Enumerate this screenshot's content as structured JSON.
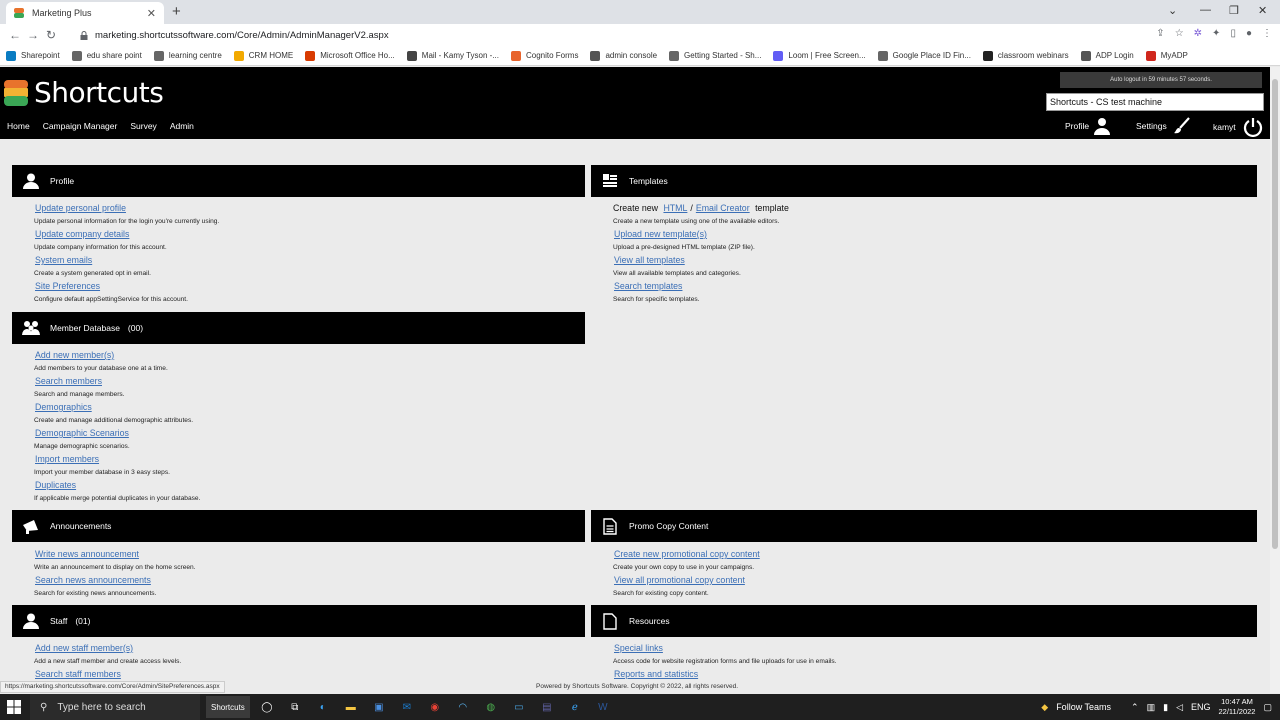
{
  "browser": {
    "tab_title": "Marketing Plus",
    "tab_close": "✕",
    "new_tab": "+",
    "url": "marketing.shortcutssoftware.com/Core/Admin/AdminManagerV2.aspx",
    "back": "←",
    "forward": "→",
    "reload": "↻",
    "bookmarks": [
      {
        "label": "Sharepoint",
        "color": "#0a7cc2"
      },
      {
        "label": "edu share point",
        "color": "#666666"
      },
      {
        "label": "learning centre",
        "color": "#666666"
      },
      {
        "label": "CRM HOME",
        "color": "#f2a900"
      },
      {
        "label": "Microsoft Office Ho...",
        "color": "#d83b01"
      },
      {
        "label": "Mail - Kamy Tyson -...",
        "color": "#444444"
      },
      {
        "label": "Cognito Forms",
        "color": "#e8642c"
      },
      {
        "label": "admin console",
        "color": "#555555"
      },
      {
        "label": "Getting Started - Sh...",
        "color": "#666666"
      },
      {
        "label": "Loom | Free Screen...",
        "color": "#625df5"
      },
      {
        "label": "Google Place ID Fin...",
        "color": "#666666"
      },
      {
        "label": "classroom webinars",
        "color": "#222222"
      },
      {
        "label": "ADP Login",
        "color": "#555555"
      },
      {
        "label": "MyADP",
        "color": "#d0271d"
      }
    ]
  },
  "app": {
    "logo_text": "Shortcuts",
    "nav": [
      "Home",
      "Campaign Manager",
      "Survey",
      "Admin"
    ],
    "logout_timer": "Auto logout in 59 minutes 57 seconds.",
    "machine": "Shortcuts - CS test machine",
    "profile": "Profile",
    "settings": "Settings",
    "user": "kamyt"
  },
  "panels": {
    "profile": {
      "title": "Profile",
      "items": [
        {
          "link": "Update personal profile",
          "desc": "Update personal information for the login you're currently using."
        },
        {
          "link": "Update company details",
          "desc": "Update company information for this account."
        },
        {
          "link": "System emails",
          "desc": "Create a system generated opt in email."
        },
        {
          "link": "Site Preferences",
          "desc": "Configure default appSettingService for this account."
        }
      ]
    },
    "templates": {
      "title": "Templates",
      "create_prefix": "Create new",
      "create_html": "HTML",
      "create_sep": "/",
      "create_email": "Email Creator",
      "create_suffix": "template",
      "create_desc": "Create a new template using one of the available editors.",
      "items": [
        {
          "link": "Upload new template(s)",
          "desc": "Upload a pre-designed HTML template (ZIP file)."
        },
        {
          "link": "View all templates",
          "desc": "View all available templates and categories."
        },
        {
          "link": "Search templates",
          "desc": "Search for specific templates."
        }
      ]
    },
    "member_db": {
      "title": "Member Database",
      "count": "(00)",
      "items": [
        {
          "link": "Add new member(s)",
          "desc": "Add members to your database one at a time."
        },
        {
          "link": "Search members",
          "desc": "Search and manage members."
        },
        {
          "link": "Demographics",
          "desc": "Create and manage additional demographic attributes."
        },
        {
          "link": "Demographic Scenarios",
          "desc": "Manage demographic scenarios."
        },
        {
          "link": "Import members",
          "desc": "Import your member database in 3 easy steps."
        },
        {
          "link": "Duplicates",
          "desc": "If applicable merge potential duplicates in your database."
        }
      ]
    },
    "announcements": {
      "title": "Announcements",
      "items": [
        {
          "link": "Write news announcement",
          "desc": "Write an announcement to display on the home screen."
        },
        {
          "link": "Search news announcements",
          "desc": "Search for existing news announcements."
        }
      ]
    },
    "promo": {
      "title": "Promo Copy Content",
      "items": [
        {
          "link": "Create new promotional copy content",
          "desc": "Create your own copy to use in your campaigns."
        },
        {
          "link": "View all promotional copy content",
          "desc": "Search for existing copy content."
        }
      ]
    },
    "staff": {
      "title": "Staff",
      "count": "(01)",
      "items": [
        {
          "link": "Add new staff member(s)",
          "desc": "Add a new staff member and create access levels."
        },
        {
          "link": "Search staff members",
          "desc": ""
        }
      ]
    },
    "resources": {
      "title": "Resources",
      "items": [
        {
          "link": "Special links",
          "desc": "Access code for website registration forms and file uploads for use in emails."
        },
        {
          "link": "Reports and statistics",
          "desc": ""
        }
      ]
    }
  },
  "status_url": "https://marketing.shortcutssoftware.com/Core/Admin/SitePreferences.aspx",
  "footer": "Powered by Shortcuts Software. Copyright © 2022, all rights reserved.",
  "taskbar": {
    "search_placeholder": "Type here to search",
    "shortcuts_app": "Shortcuts",
    "follow_teams": "Follow Teams",
    "lang": "ENG",
    "time": "10:47 AM",
    "date": "22/11/2022"
  }
}
